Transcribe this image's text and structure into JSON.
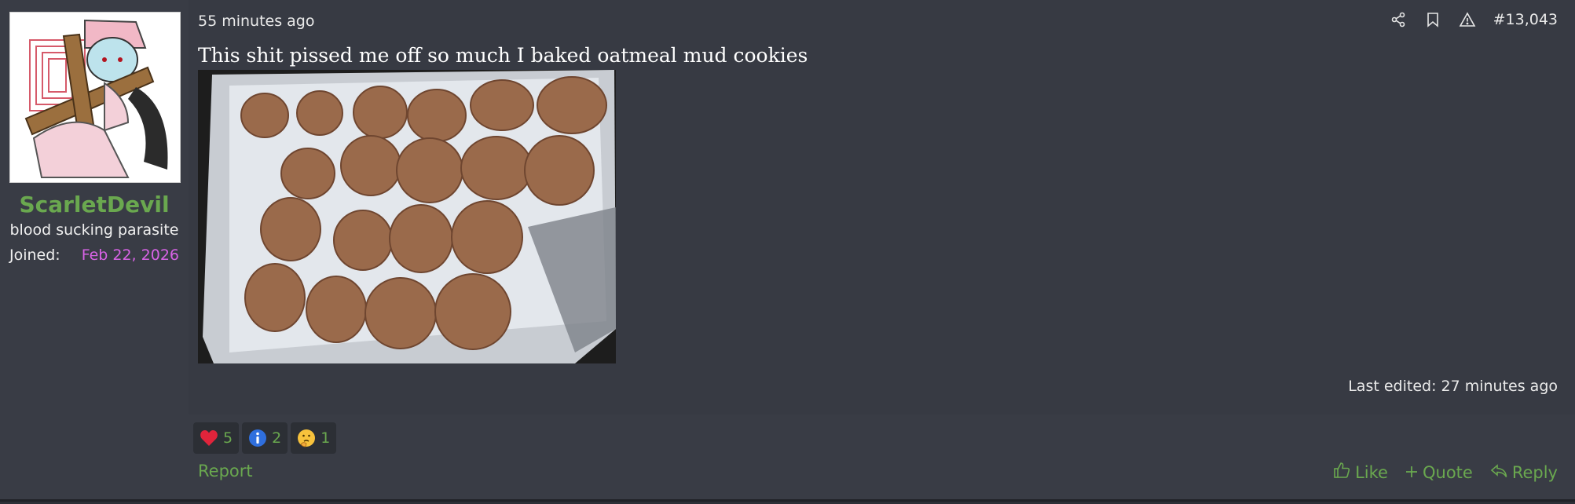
{
  "post": {
    "author": {
      "username": "ScarletDevil",
      "title": "blood sucking parasite",
      "joined_label": "Joined:",
      "joined_value": "Feb 22, 2026"
    },
    "timestamp": "55 minutes ago",
    "post_number": "#13,043",
    "message": "This shit pissed me off so much I baked oatmeal mud cookies",
    "last_edited": "Last edited: 27 minutes ago",
    "reactions": [
      {
        "icon": "heart-icon",
        "count": "5"
      },
      {
        "icon": "info-icon",
        "count": "2"
      },
      {
        "icon": "thinking-face-icon",
        "count": "1"
      }
    ],
    "report_label": "Report",
    "actions": {
      "like": "Like",
      "quote": "Quote",
      "reply": "Reply"
    }
  },
  "colors": {
    "accent_green": "#6aa84f",
    "join_date": "#d863e6",
    "post_background": "#373a43"
  }
}
